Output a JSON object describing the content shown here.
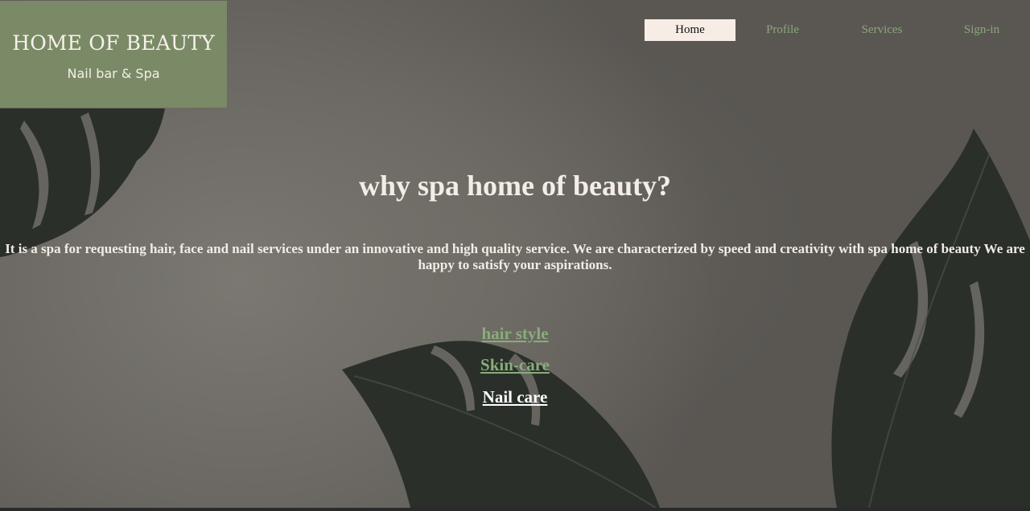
{
  "brand": {
    "title": "HOME OF BEAUTY",
    "subtitle": "Nail bar & Spa"
  },
  "nav": {
    "items": [
      {
        "label": "Home",
        "active": true
      },
      {
        "label": "Profile",
        "active": false
      },
      {
        "label": "Services",
        "active": false
      },
      {
        "label": "Sign-in",
        "active": false
      }
    ]
  },
  "hero": {
    "title": "why spa home of beauty?",
    "text": "It is a spa for requesting hair, face and nail services under an innovative and high quality service. We are characterized by speed and creativity with spa home of beauty We are happy to satisfy your aspirations."
  },
  "services": {
    "links": [
      {
        "label": "hair style"
      },
      {
        "label": "Skin-care"
      },
      {
        "label": "Nail care"
      }
    ]
  },
  "colors": {
    "brand_bg": "#7a8a66",
    "nav_link": "#8aa67a",
    "nav_active_bg": "#f8ede6",
    "service_link": "#88ad7a",
    "text_light": "#f4ede6"
  }
}
